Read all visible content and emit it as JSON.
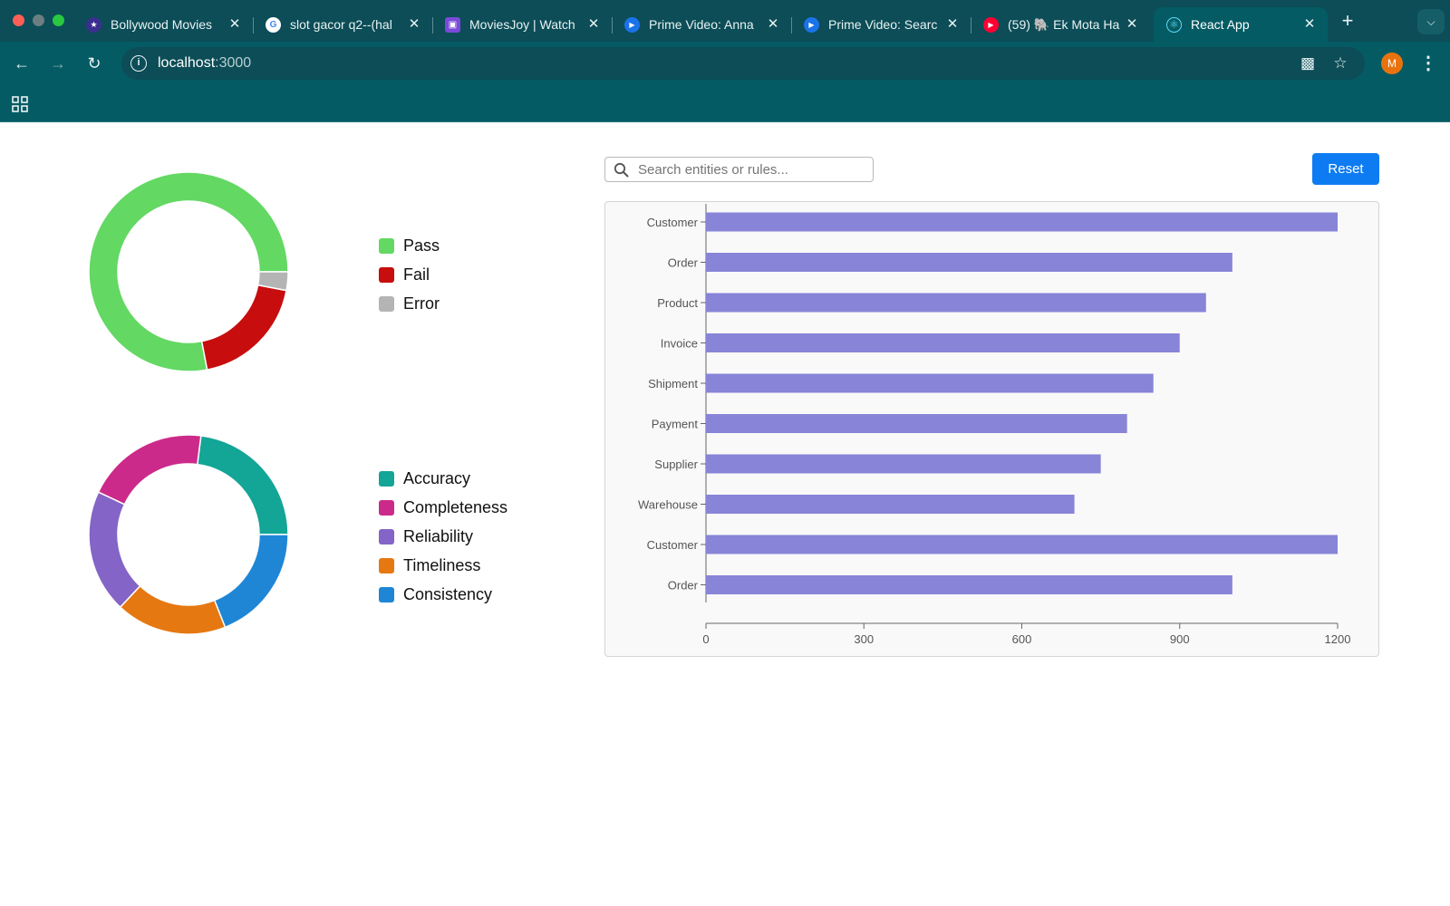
{
  "browser": {
    "tabs": [
      {
        "label": "Bollywood Movies",
        "favicon": "film-icon",
        "color": "#3a2f8f",
        "active": false
      },
      {
        "label": "slot gacor q2--(hal",
        "favicon": "google-icon",
        "color": "#ffffff",
        "active": false
      },
      {
        "label": "MoviesJoy | Watch",
        "favicon": "clapper-icon",
        "color": "#7b4ad9",
        "active": false
      },
      {
        "label": "Prime Video: Anna",
        "favicon": "play-icon",
        "color": "#1a73e8",
        "active": false
      },
      {
        "label": "Prime Video: Searc",
        "favicon": "play-icon",
        "color": "#1a73e8",
        "active": false
      },
      {
        "label": "(59) 🐘 Ek Mota Ha",
        "favicon": "youtube-icon",
        "color": "#ff0033",
        "active": false
      },
      {
        "label": "React App",
        "favicon": "react-icon",
        "color": "#61dafb",
        "active": true
      }
    ],
    "url_host": "localhost",
    "url_port": ":3000",
    "avatar_initial": "M"
  },
  "search": {
    "placeholder": "Search entities or rules..."
  },
  "reset_label": "Reset",
  "status_legend": [
    {
      "label": "Pass",
      "color": "#63d863"
    },
    {
      "label": "Fail",
      "color": "#c70d0d"
    },
    {
      "label": "Error",
      "color": "#b4b4b4"
    }
  ],
  "dimension_legend": [
    {
      "label": "Accuracy",
      "color": "#13a596"
    },
    {
      "label": "Completeness",
      "color": "#cc2a8a"
    },
    {
      "label": "Reliability",
      "color": "#8464c6"
    },
    {
      "label": "Timeliness",
      "color": "#e67811"
    },
    {
      "label": "Consistency",
      "color": "#1f86d6"
    }
  ],
  "chart_data": [
    {
      "type": "pie",
      "categories": [
        "Pass",
        "Fail",
        "Error"
      ],
      "values": [
        78,
        19,
        3
      ],
      "colors": [
        "#63d863",
        "#c70d0d",
        "#b4b4b4"
      ]
    },
    {
      "type": "pie",
      "categories": [
        "Accuracy",
        "Completeness",
        "Reliability",
        "Timeliness",
        "Consistency"
      ],
      "values": [
        23,
        20,
        20,
        18,
        19
      ],
      "colors": [
        "#13a596",
        "#cc2a8a",
        "#8464c6",
        "#e67811",
        "#1f86d6"
      ]
    },
    {
      "type": "bar",
      "orientation": "horizontal",
      "categories": [
        "Customer",
        "Order",
        "Product",
        "Invoice",
        "Shipment",
        "Payment",
        "Supplier",
        "Warehouse",
        "Customer",
        "Order"
      ],
      "values": [
        1200,
        1000,
        950,
        900,
        850,
        800,
        750,
        700,
        1200,
        1000
      ],
      "xticks": [
        0,
        300,
        600,
        900,
        1200
      ],
      "xlim": [
        0,
        1200
      ],
      "color": "#8884d8",
      "grid": false
    }
  ]
}
